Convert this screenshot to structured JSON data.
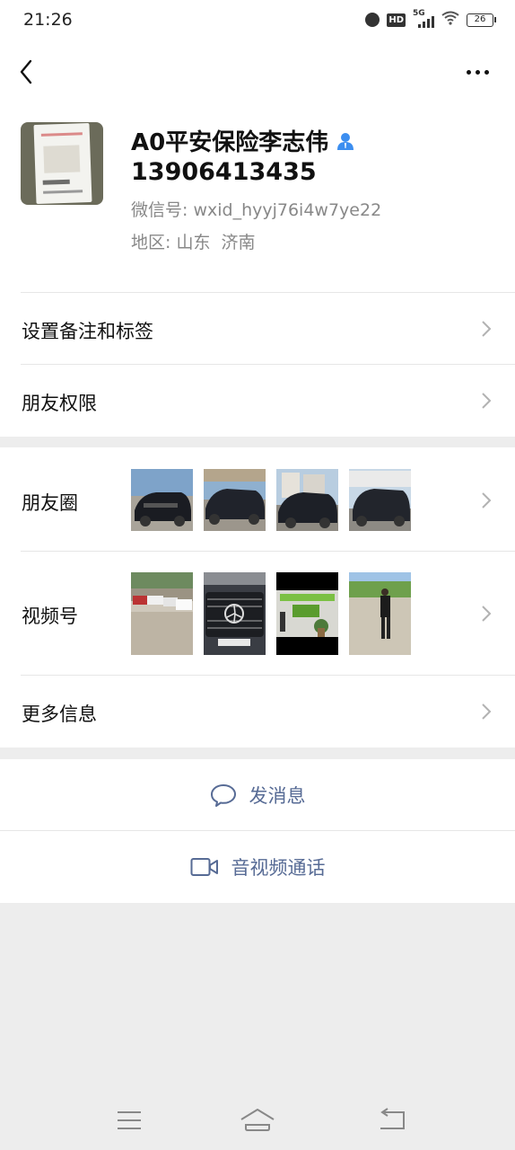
{
  "status_bar": {
    "time": "21:26",
    "icons": [
      "alarm-icon",
      "hd-icon",
      "5g-signal-icon",
      "wifi-icon",
      "battery-icon"
    ],
    "hd_label": "HD",
    "network_label": "5G",
    "battery_level": "26"
  },
  "nav": {
    "back_icon": "chevron-left-icon",
    "more_icon": "more-dots-icon"
  },
  "profile": {
    "name": "A0平安保险李志伟",
    "phone": "13906413435",
    "wechat_id_label": "微信号:",
    "wechat_id": "wxid_hyyj76i4w7ye22",
    "region_label": "地区:",
    "region": "山东  济南"
  },
  "menu": {
    "remarks_tags": "设置备注和标签",
    "friend_permissions": "朋友权限",
    "moments": "朋友圈",
    "channels": "视频号",
    "more_info": "更多信息"
  },
  "actions": {
    "send_message": "发消息",
    "video_call": "音视频通话"
  },
  "colors": {
    "link_blue": "#576b95",
    "background": "#ededed",
    "card_bg": "#ffffff"
  }
}
